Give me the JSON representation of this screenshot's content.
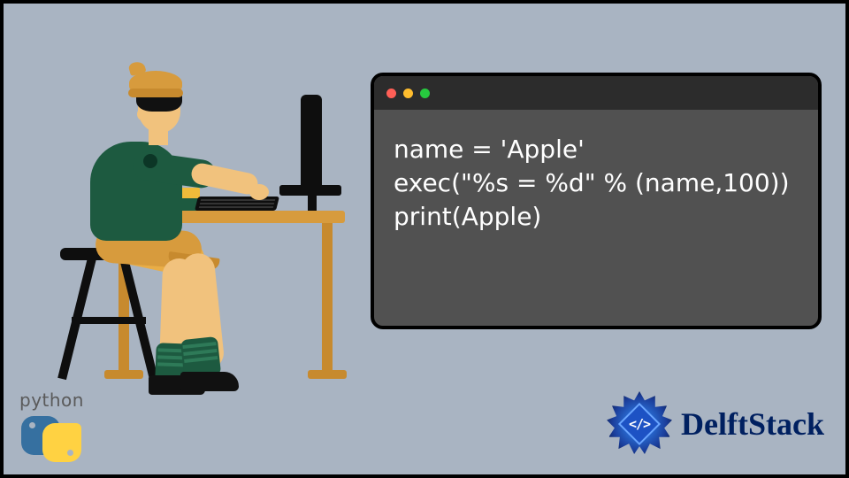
{
  "code_window": {
    "traffic_lights": [
      "close",
      "minimize",
      "zoom"
    ],
    "lines": [
      "name = 'Apple'",
      "exec(\"%s = %d\" % (name,100))",
      "print(Apple)"
    ]
  },
  "python_badge": {
    "label": "python"
  },
  "delftstack_badge": {
    "label": "DelftStack",
    "logo_code": "</>"
  },
  "colors": {
    "background": "#a9b4c2",
    "window_body": "#515151",
    "window_titlebar": "#2c2c2c",
    "code_text": "#ffffff",
    "border": "#000000",
    "brand_text": "#002060",
    "python_blue": "#3670a0",
    "python_yellow": "#ffd242"
  }
}
